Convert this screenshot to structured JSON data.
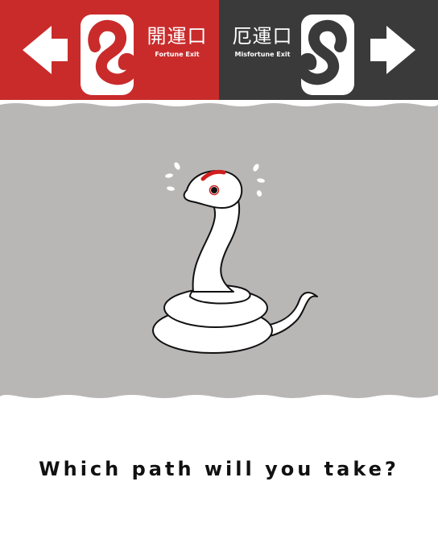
{
  "colors": {
    "fortune_bg": "#c92b2b",
    "misfortune_bg": "#3a3a3a",
    "scene_bg": "#b9b6b6",
    "snake_red": "#d01f1f"
  },
  "signs": {
    "fortune": {
      "kanji": "開運口",
      "label": "Fortune Exit",
      "arrow": "left-arrow-icon"
    },
    "misfortune": {
      "kanji": "厄運口",
      "label": "Misfortune Exit",
      "arrow": "right-arrow-icon"
    }
  },
  "prompt": {
    "text": "Which path will you take?"
  }
}
